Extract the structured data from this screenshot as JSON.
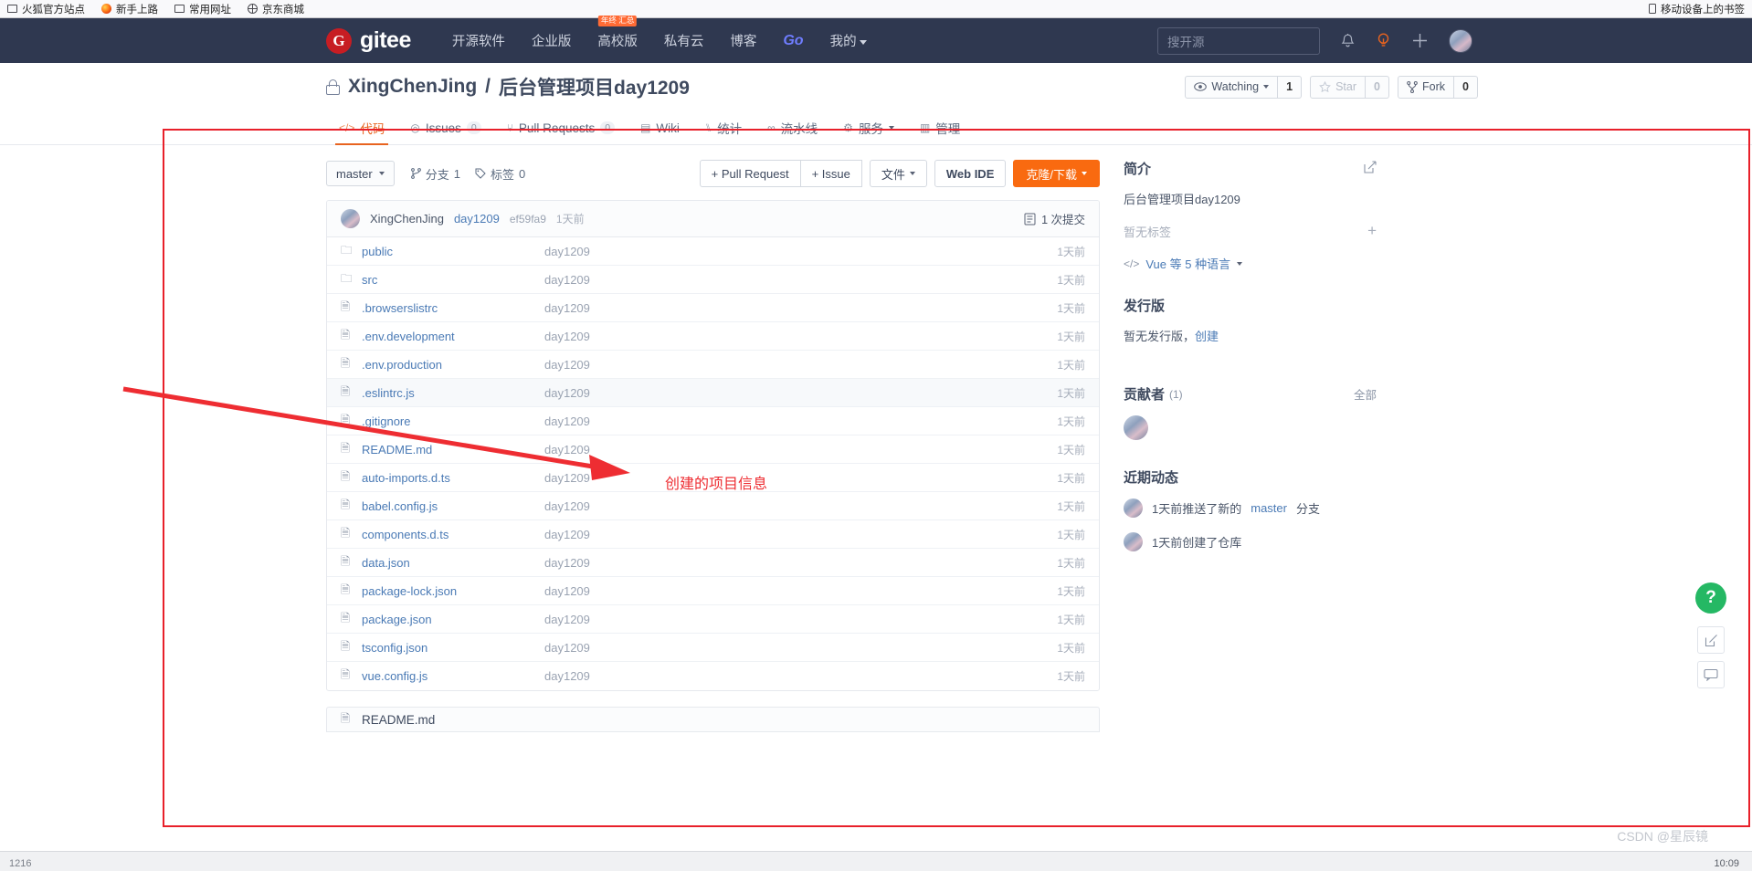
{
  "browser": {
    "bookmarks": [
      {
        "icon": "folder-icon",
        "label": "火狐官方站点"
      },
      {
        "icon": "firefox-icon",
        "label": "新手上路"
      },
      {
        "icon": "folder-icon",
        "label": "常用网址"
      },
      {
        "icon": "globe-icon",
        "label": "京东商城"
      }
    ],
    "mobile_bookmarks": {
      "icon": "phone-icon",
      "label": "移动设备上的书签"
    },
    "status_left": "1216",
    "status_right": "10:09"
  },
  "navbar": {
    "logo_mark": "G",
    "logo_text": "gitee",
    "links": [
      {
        "label": "开源软件",
        "badge": ""
      },
      {
        "label": "企业版",
        "badge": ""
      },
      {
        "label": "高校版",
        "badge": "年终\n汇总"
      },
      {
        "label": "私有云",
        "badge": ""
      },
      {
        "label": "博客",
        "badge": ""
      },
      {
        "label": "Go",
        "badge": ""
      },
      {
        "label": "我的",
        "badge": "",
        "caret": true
      }
    ],
    "search_placeholder": "搜开源",
    "icons": [
      "bell-icon",
      "lightbulb-icon",
      "plus-icon",
      "avatar"
    ],
    "accent": "#c71d23",
    "bg": "#2f3850"
  },
  "repo": {
    "owner": "XingChenJing",
    "separator": "/",
    "name": "后台管理项目day1209",
    "visibility_icon": "lock-icon",
    "watch": {
      "label": "Watching",
      "count": "1"
    },
    "star": {
      "label": "Star",
      "count": "0"
    },
    "fork": {
      "label": "Fork",
      "count": "0"
    }
  },
  "tabs": [
    {
      "icon": "code-icon",
      "label": "代码",
      "count": "",
      "active": true
    },
    {
      "icon": "issue-icon",
      "label": "Issues",
      "count": "0",
      "active": false
    },
    {
      "icon": "pr-icon",
      "label": "Pull Requests",
      "count": "0",
      "active": false
    },
    {
      "icon": "wiki-icon",
      "label": "Wiki",
      "count": "",
      "active": false
    },
    {
      "icon": "chart-icon",
      "label": "统计",
      "count": "",
      "active": false
    },
    {
      "icon": "pipeline-icon",
      "label": "流水线",
      "count": "",
      "active": false
    },
    {
      "icon": "service-icon",
      "label": "服务",
      "count": "",
      "active": false,
      "caret": true
    },
    {
      "icon": "manage-icon",
      "label": "管理",
      "count": "",
      "active": false
    }
  ],
  "toolbar": {
    "branch": "master",
    "branches": {
      "icon": "branch-icon",
      "label": "分支",
      "count": "1"
    },
    "tags": {
      "icon": "tag-icon",
      "label": "标签",
      "count": "0"
    },
    "pull_request": "+ Pull Request",
    "issue": "+ Issue",
    "files": "文件",
    "web_ide": "Web IDE",
    "clone": "克隆/下载",
    "clone_color": "#f96a10"
  },
  "commit": {
    "author": "XingChenJing",
    "message": "day1209",
    "sha": "ef59fa9",
    "time": "1天前",
    "count_label": "1 次提交",
    "count_icon": "history-icon"
  },
  "files": [
    {
      "icon": "folder-icon",
      "name": "public",
      "message": "day1209",
      "time": "1天前",
      "highlight": false
    },
    {
      "icon": "folder-icon",
      "name": "src",
      "message": "day1209",
      "time": "1天前",
      "highlight": false
    },
    {
      "icon": "file-icon",
      "name": ".browserslistrc",
      "message": "day1209",
      "time": "1天前",
      "highlight": false
    },
    {
      "icon": "file-icon",
      "name": ".env.development",
      "message": "day1209",
      "time": "1天前",
      "highlight": false
    },
    {
      "icon": "file-icon",
      "name": ".env.production",
      "message": "day1209",
      "time": "1天前",
      "highlight": false
    },
    {
      "icon": "file-icon",
      "name": ".eslintrc.js",
      "message": "day1209",
      "time": "1天前",
      "highlight": true
    },
    {
      "icon": "file-icon",
      "name": ".gitignore",
      "message": "day1209",
      "time": "1天前",
      "highlight": false
    },
    {
      "icon": "file-icon",
      "name": "README.md",
      "message": "day1209",
      "time": "1天前",
      "highlight": false
    },
    {
      "icon": "file-icon",
      "name": "auto-imports.d.ts",
      "message": "day1209",
      "time": "1天前",
      "highlight": false
    },
    {
      "icon": "file-icon",
      "name": "babel.config.js",
      "message": "day1209",
      "time": "1天前",
      "highlight": false
    },
    {
      "icon": "file-icon",
      "name": "components.d.ts",
      "message": "day1209",
      "time": "1天前",
      "highlight": false
    },
    {
      "icon": "file-icon",
      "name": "data.json",
      "message": "day1209",
      "time": "1天前",
      "highlight": false
    },
    {
      "icon": "file-icon",
      "name": "package-lock.json",
      "message": "day1209",
      "time": "1天前",
      "highlight": false
    },
    {
      "icon": "file-icon",
      "name": "package.json",
      "message": "day1209",
      "time": "1天前",
      "highlight": false
    },
    {
      "icon": "file-icon",
      "name": "tsconfig.json",
      "message": "day1209",
      "time": "1天前",
      "highlight": false
    },
    {
      "icon": "file-icon",
      "name": "vue.config.js",
      "message": "day1209",
      "time": "1天前",
      "highlight": false
    }
  ],
  "readme_peek": {
    "icon": "file-icon",
    "label": "README.md"
  },
  "sidebar": {
    "intro_title": "简介",
    "intro_edit_icon": "edit-icon",
    "intro_text": "后台管理项目day1209",
    "no_tags": "暂无标签",
    "add_tag_icon": "plus-icon",
    "language": "Vue 等 5 种语言",
    "language_icon": "code-icon",
    "release_title": "发行版",
    "release_none": "暂无发行版，",
    "release_create": "创建",
    "contributors_title": "贡献者",
    "contributors_count": "(1)",
    "contributors_all": "全部",
    "activity_title": "近期动态",
    "activities": [
      {
        "prefix": "1天前推送了新的",
        "highlight": "master",
        "suffix": "分支"
      },
      {
        "prefix": "1天前创建了仓库",
        "highlight": "",
        "suffix": ""
      }
    ]
  },
  "floating": {
    "help": "?",
    "buttons": [
      "edit-icon",
      "feedback-icon"
    ]
  },
  "annotation": {
    "label": "创建的项目信息",
    "color": "#ee2d32"
  },
  "watermark": "CSDN @星辰镜"
}
